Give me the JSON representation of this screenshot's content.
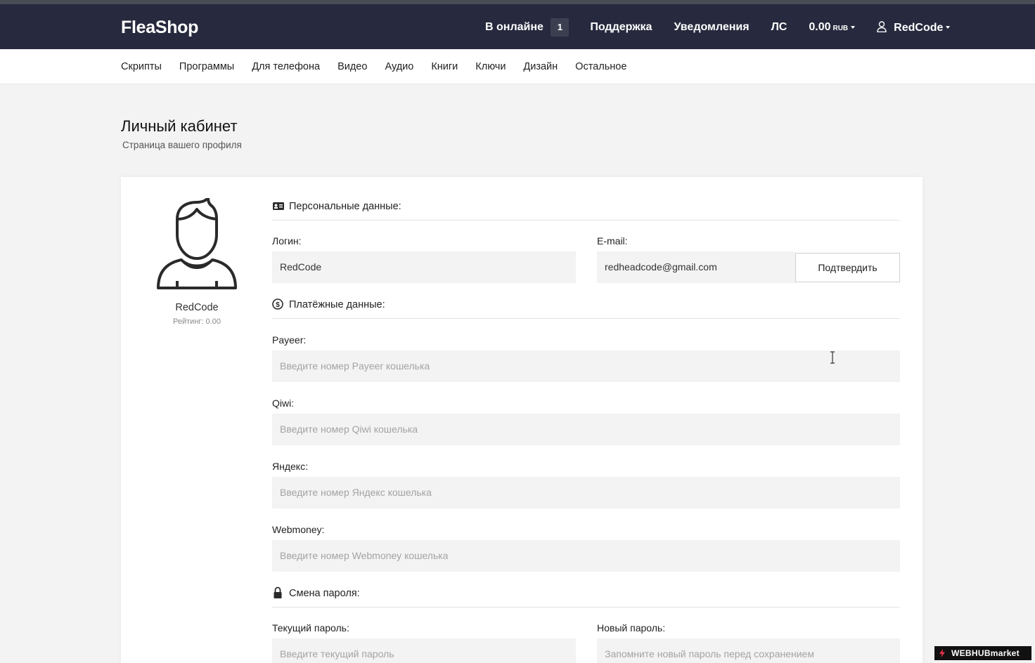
{
  "header": {
    "logo": "FleaShop",
    "online_label": "В онлайне",
    "online_count": "1",
    "support": "Поддержка",
    "notifications": "Уведомления",
    "messages": "ЛС",
    "balance": "0.00",
    "currency": "RUB",
    "username": "RedCode"
  },
  "categories": [
    "Скрипты",
    "Программы",
    "Для телефона",
    "Видео",
    "Аудио",
    "Книги",
    "Ключи",
    "Дизайн",
    "Остальное"
  ],
  "page": {
    "title": "Личный кабинет",
    "subtitle": "Страница вашего профиля"
  },
  "profile": {
    "name": "RedCode",
    "rating": "Рейтинг: 0.00"
  },
  "personal": {
    "heading": "Персональные данные:",
    "login_label": "Логин:",
    "login_value": "RedCode",
    "email_label": "E-mail:",
    "email_value": "redheadcode@gmail.com",
    "confirm_button": "Подтвердить"
  },
  "payment": {
    "heading": "Платёжные данные:",
    "payeer_label": "Payeer:",
    "payeer_placeholder": "Введите номер Payeer кошелька",
    "qiwi_label": "Qiwi:",
    "qiwi_placeholder": "Введите номер Qiwi кошелька",
    "yandex_label": "Яндекс:",
    "yandex_placeholder": "Введите номер Яндекс кошелька",
    "webmoney_label": "Webmoney:",
    "webmoney_placeholder": "Введите номер Webmoney кошелька"
  },
  "password": {
    "heading": "Смена пароля:",
    "current_label": "Текущий пароль:",
    "current_placeholder": "Введите текущий пароль",
    "new_label": "Новый пароль:",
    "new_placeholder": "Запомните новый пароль перед сохранением"
  },
  "watermark": "WEBHUBmarket",
  "colors": {
    "navbar": "#272a3e",
    "background": "#f3f3f3",
    "field": "#f3f3f3"
  }
}
